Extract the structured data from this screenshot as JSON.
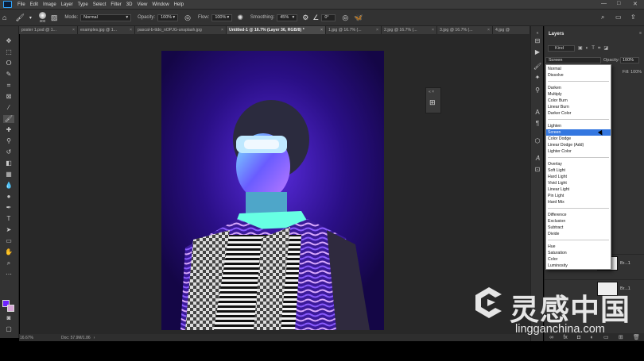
{
  "menubar": {
    "items": [
      "File",
      "Edit",
      "Image",
      "Layer",
      "Type",
      "Select",
      "Filter",
      "3D",
      "View",
      "Window",
      "Help"
    ],
    "window_controls": [
      "—",
      "□",
      "✕"
    ]
  },
  "options": {
    "brush_size": "300",
    "mode_label": "Mode:",
    "mode_value": "Normal",
    "opacity_label": "Opacity:",
    "opacity_value": "100%",
    "flow_label": "Flow:",
    "flow_value": "100%",
    "smoothing_label": "Smoothing:",
    "smoothing_value": "45%",
    "angle_value": "0°"
  },
  "tabs": [
    {
      "label": "poster 1.psd @ 1..."
    },
    {
      "label": "examples.jpg @ 1..."
    },
    {
      "label": "pascal-b-ttdo_nOPJG-unsplash.jpg"
    },
    {
      "label": "Untitled-1 @ 16.7% (Layer 36, RGB/8) *"
    },
    {
      "label": "1.jpg @ 16.7% (..."
    },
    {
      "label": "2.jpg @ 16.7% (..."
    },
    {
      "label": "3.jpg @ 16.7% (..."
    },
    {
      "label": "4.jpg @"
    }
  ],
  "status": {
    "zoom": "16.67%",
    "doc": "Doc: 57.9M/1.86"
  },
  "colors": {
    "foreground": "#6f22ff",
    "background": "#d8a6d8",
    "selection": "#3477e0"
  },
  "layers_panel": {
    "title": "Layers",
    "kind": "Kind",
    "blend_mode": "Screen",
    "opacity_label": "Opacity:",
    "opacity_value": "100%",
    "fill_label": "Fill:",
    "fill_value": "100%",
    "layers": [
      {
        "name": "Br...1"
      },
      {
        "name": "Br...1"
      }
    ]
  },
  "blend_dropdown": {
    "groups": [
      [
        "Normal",
        "Dissolve"
      ],
      [
        "Darken",
        "Multiply",
        "Color Burn",
        "Linear Burn",
        "Darker Color"
      ],
      [
        "Lighten",
        "Screen",
        "Color Dodge",
        "Linear Dodge (Add)",
        "Lighter Color"
      ],
      [
        "Overlay",
        "Soft Light",
        "Hard Light",
        "Vivid Light",
        "Linear Light",
        "Pin Light",
        "Hard Mix"
      ],
      [
        "Difference",
        "Exclusion",
        "Subtract",
        "Divide"
      ],
      [
        "Hue",
        "Saturation",
        "Color",
        "Luminosity"
      ]
    ],
    "selected": "Screen"
  },
  "watermark": {
    "cn": "灵感中国",
    "url": "lingganchina.com"
  }
}
